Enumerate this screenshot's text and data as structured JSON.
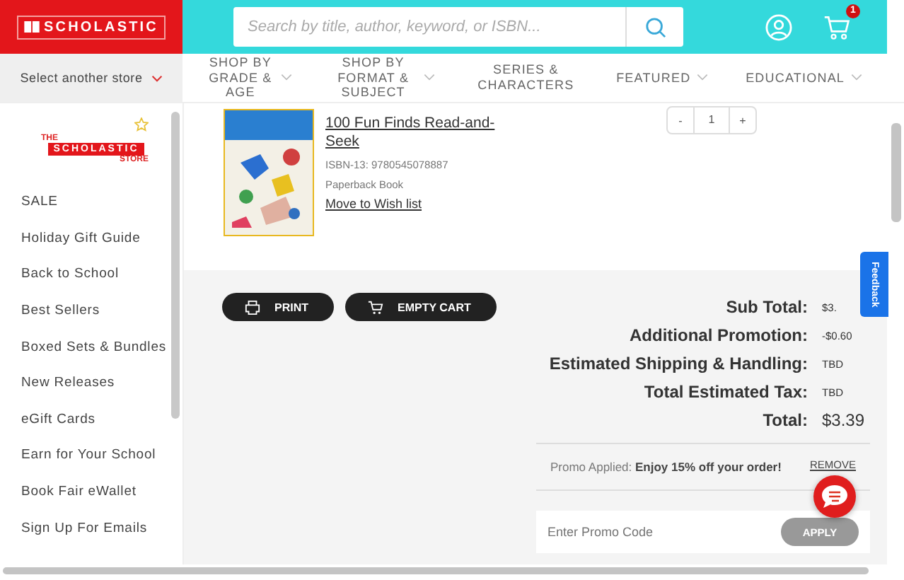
{
  "header": {
    "logo": "SCHOLASTIC",
    "search": {
      "placeholder": "Search by title, author, keyword, or ISBN..."
    },
    "cart_count": "1"
  },
  "store_select": "Select another store",
  "nav": [
    {
      "label": "SHOP BY GRADE & AGE",
      "dropdown": true
    },
    {
      "label": "SHOP BY FORMAT & SUBJECT",
      "dropdown": true
    },
    {
      "label": "SERIES & CHARACTERS",
      "dropdown": false
    },
    {
      "label": "FEATURED",
      "dropdown": true
    },
    {
      "label": "EDUCATIONAL",
      "dropdown": true
    }
  ],
  "sidebar": {
    "logo": {
      "top": "THE",
      "brand": "SCHOLASTIC",
      "bottom": "STORE"
    },
    "items": [
      "SALE",
      "Holiday Gift Guide",
      "Back to School",
      "Best Sellers",
      "Boxed Sets & Bundles",
      "New Releases",
      "eGift Cards",
      "Earn for Your School",
      "Book Fair eWallet",
      "Sign Up For Emails"
    ]
  },
  "product": {
    "title": "100 Fun Finds Read-and-Seek",
    "isbn": "ISBN-13: 9780545078887",
    "format": "Paperback Book",
    "wishlist": "Move to Wish list",
    "quantity": {
      "minus": "-",
      "value": "1",
      "plus": "+"
    }
  },
  "actions": [
    {
      "kind": "print",
      "label": "PRINT"
    },
    {
      "kind": "cart",
      "label": "EMPTY CART"
    }
  ],
  "summary": [
    {
      "label": "Sub Total:",
      "value": "$3.",
      "kind": "line"
    },
    {
      "label": "Additional Promotion:",
      "value": "-$0.60",
      "kind": "line"
    },
    {
      "label": "Estimated Shipping & Handling:",
      "value": "TBD",
      "kind": "line"
    },
    {
      "label": "Total Estimated Tax:",
      "value": "TBD",
      "kind": "line"
    },
    {
      "label": "Total:",
      "value": "$3.39",
      "kind": "total"
    }
  ],
  "promo": {
    "text": "Promo Applied: **Enjoy 15% off your order!**",
    "remove": "REMOVE"
  },
  "promo_field": {
    "placeholder": "Enter Promo Code",
    "button": "APPLY"
  },
  "feedback": "Feedback"
}
